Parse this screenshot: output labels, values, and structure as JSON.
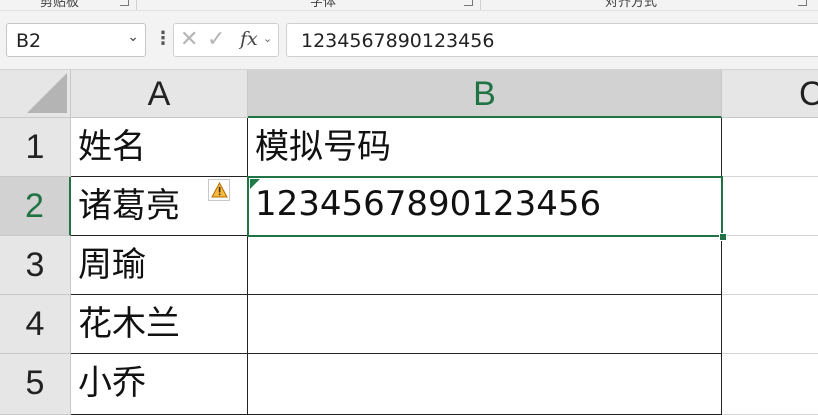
{
  "ribbon": {
    "groups": [
      "剪贴板",
      "字体",
      "对齐方式"
    ]
  },
  "formula_bar": {
    "name_box": "B2",
    "formula": "1234567890123456",
    "fx_label": "fx"
  },
  "columns": [
    "A",
    "B",
    "C"
  ],
  "rows": [
    {
      "num": "1",
      "a": "姓名",
      "b": "模拟号码"
    },
    {
      "num": "2",
      "a": "诸葛亮",
      "b": "1234567890123456"
    },
    {
      "num": "3",
      "a": "周瑜",
      "b": ""
    },
    {
      "num": "4",
      "a": "花木兰",
      "b": ""
    },
    {
      "num": "5",
      "a": "小乔",
      "b": ""
    }
  ],
  "selection": {
    "cell": "B2",
    "column": "B",
    "row": "2"
  },
  "error_indicator": {
    "cell": "B2",
    "icon": "warning-icon",
    "color": "#1e7b45"
  },
  "accent_color": "#217346"
}
